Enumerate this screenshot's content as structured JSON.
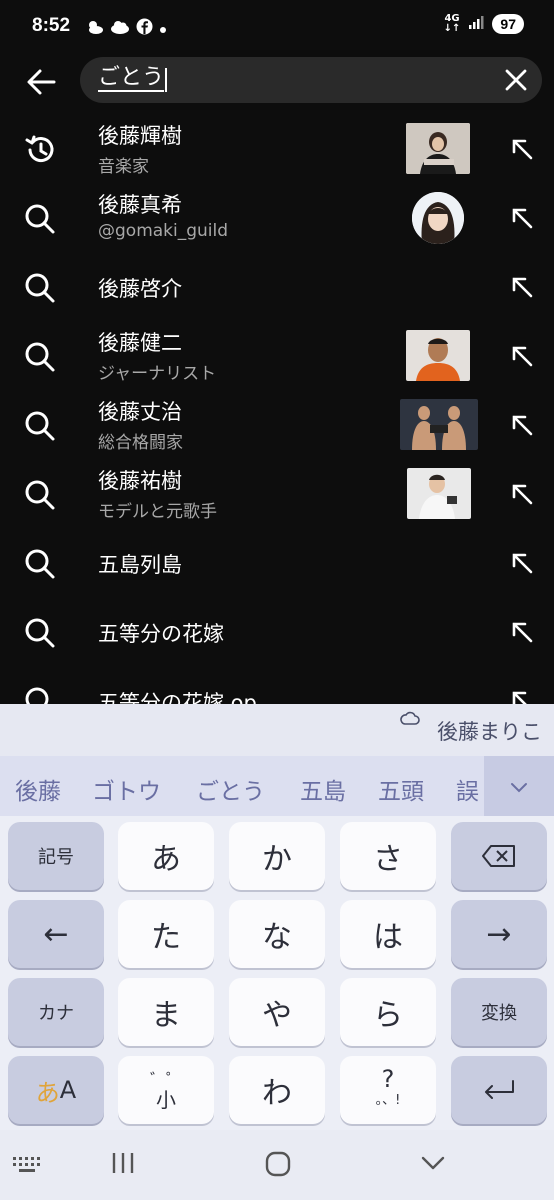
{
  "status_bar": {
    "time": "8:52",
    "network": "4G",
    "battery": "97"
  },
  "search": {
    "query": "ごとう"
  },
  "results": [
    {
      "type": "history",
      "title": "後藤輝樹",
      "subtitle": "音楽家",
      "thumbnail": "photo"
    },
    {
      "type": "search",
      "title": "後藤真希",
      "subtitle": "@gomaki_guild",
      "thumbnail": "avatar"
    },
    {
      "type": "search",
      "title": "後藤啓介",
      "subtitle": ""
    },
    {
      "type": "search",
      "title": "後藤健二",
      "subtitle": "ジャーナリスト",
      "thumbnail": "photo"
    },
    {
      "type": "search",
      "title": "後藤丈治",
      "subtitle": "総合格闘家",
      "thumbnail": "photo"
    },
    {
      "type": "search",
      "title": "後藤祐樹",
      "subtitle": "モデルと元歌手",
      "thumbnail": "photo"
    },
    {
      "type": "search",
      "title": "五島列島",
      "subtitle": ""
    },
    {
      "type": "search",
      "title": "五等分の花嫁",
      "subtitle": ""
    },
    {
      "type": "search",
      "title": "五等分の花嫁 op",
      "subtitle": ""
    }
  ],
  "keyboard": {
    "ai_suggestion": "後藤まりこ",
    "candidates": [
      "後藤",
      "ゴトウ",
      "ごとう",
      "五島",
      "五頭",
      "誤"
    ],
    "keys": {
      "symbols": "記号",
      "a": "あ",
      "ka": "か",
      "sa": "さ",
      "left": "←",
      "ta": "た",
      "na": "な",
      "ha": "は",
      "right": "→",
      "kana": "カナ",
      "ma": "ま",
      "ya": "や",
      "ra": "ら",
      "convert": "変換",
      "mode_hira": "あ",
      "mode_alpha": "A",
      "small": "小",
      "dakuten": "゛゜",
      "wa": "わ",
      "punct": "?",
      "punct_sub": "。、!"
    }
  },
  "colors": {
    "background": "#0d0d0d",
    "searchbox": "#2a2a2a",
    "keyboard": "#e8eaf3",
    "candidate": "#6a6fa3",
    "mode_accent": "#e0a43a"
  }
}
